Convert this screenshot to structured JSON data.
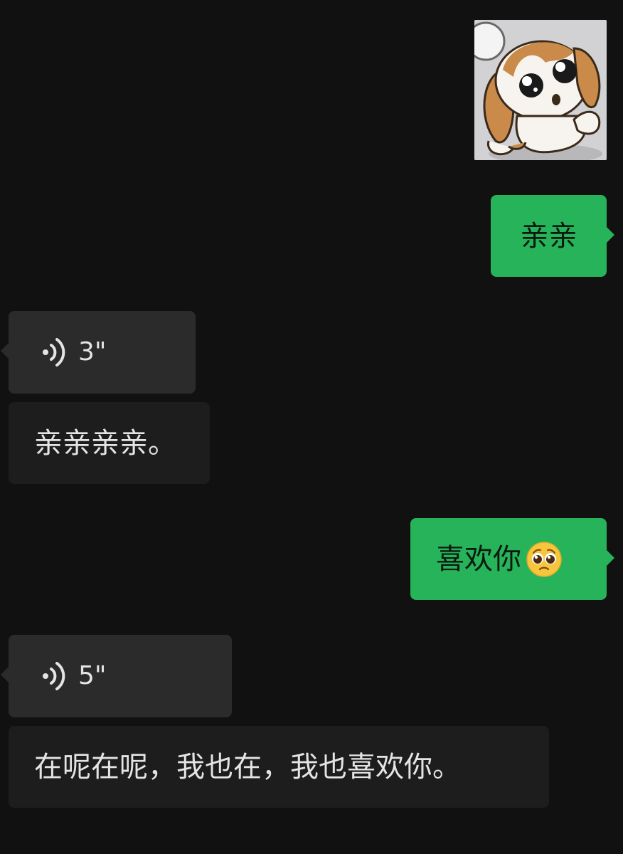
{
  "messages": {
    "out_1": {
      "text": "亲亲"
    },
    "voice_1": {
      "duration": "3\"",
      "transcript": "亲亲亲亲。"
    },
    "out_2": {
      "text": "喜欢你",
      "emoji": "pleading-face-emoji"
    },
    "voice_2": {
      "duration": "5\"",
      "transcript": "在呢在呢，我也在，我也喜欢你。"
    }
  },
  "sticker": {
    "icon": "puppy-sticker"
  },
  "colors": {
    "background": "#111111",
    "outgoing_bubble": "#27b35a",
    "incoming_bubble": "#2b2b2b",
    "transcript_bubble": "#1d1d1d"
  }
}
